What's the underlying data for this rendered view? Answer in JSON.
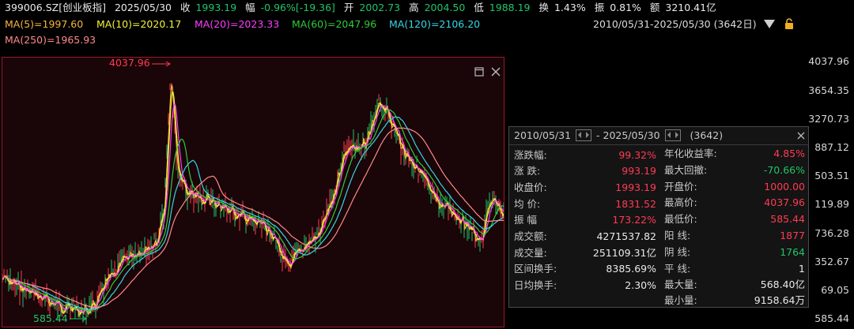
{
  "header": {
    "code": "399006.SZ[创业板指]",
    "date": "2025/05/30",
    "close_label": "收",
    "close_value": "1993.19",
    "change_label": "幅",
    "change_value": "-0.96%[-19.36]",
    "open_label": "开",
    "open_value": "2002.73",
    "high_label": "高",
    "high_value": "2004.50",
    "low_label": "低",
    "low_value": "1988.19",
    "turnover_label": "换",
    "turnover_value": "1.43%",
    "amplitude_label": "振",
    "amplitude_value": "0.81%",
    "amount_label": "额",
    "amount_value": "3210.41亿"
  },
  "ma": {
    "ma5": "MA(5)=1997.60",
    "ma10": "MA(10)=2020.17",
    "ma20": "MA(20)=2023.33",
    "ma60": "MA(60)=2047.96",
    "ma120": "MA(120)=2106.20",
    "ma250": "MA(250)=1965.93"
  },
  "colors": {
    "ma5": "#f5b53f",
    "ma10": "#f2f23e",
    "ma20": "#ff3dff",
    "ma60": "#2ecc3a",
    "ma120": "#35d6e6",
    "ma250": "#ff8a8a",
    "up": "#ff3b53",
    "down": "#20c46a"
  },
  "range": {
    "label": "2010/05/31-2025/05/30 (3642日)"
  },
  "chart": {
    "max_label": "4037.96",
    "min_label": "585.44",
    "yaxis": [
      "4037.96",
      "3654.35",
      "3270.73",
      "887.12",
      "503.51",
      "119.89",
      "736.28",
      "352.67",
      "69.05",
      "585.44"
    ]
  },
  "panel": {
    "start": "2010/05/31",
    "end": "- 2025/05/30",
    "count": "(3642)",
    "left": [
      {
        "label": "涨跌幅:",
        "value": "99.32%"
      },
      {
        "label": "涨    跌:",
        "value": "993.19"
      },
      {
        "label": "收盘价:",
        "value": "1993.19"
      },
      {
        "label": "均    价:",
        "value": "1831.52"
      },
      {
        "label": "振    幅",
        "value": "173.22%"
      },
      {
        "label": "成交额:",
        "value": "4271537.82"
      },
      {
        "label": "成交量:",
        "value": "251109.31亿"
      },
      {
        "label": "区间换手:",
        "value": "8385.69%"
      },
      {
        "label": "日均换手:",
        "value": "2.30%"
      }
    ],
    "right": [
      {
        "label": "年化收益率:",
        "value": "4.85%"
      },
      {
        "label": "最大回撤:",
        "value": "-70.66%"
      },
      {
        "label": "开盘价:",
        "value": "1000.00"
      },
      {
        "label": "最高价:",
        "value": "4037.96"
      },
      {
        "label": "最低价:",
        "value": "585.44"
      },
      {
        "label": "阳    线:",
        "value": "1877"
      },
      {
        "label": "阴    线:",
        "value": "1764"
      },
      {
        "label": "平    线:",
        "value": "1"
      },
      {
        "label": "最大量:",
        "value": "568.40亿"
      },
      {
        "label": "最小量:",
        "value": "9158.64万"
      }
    ]
  }
}
